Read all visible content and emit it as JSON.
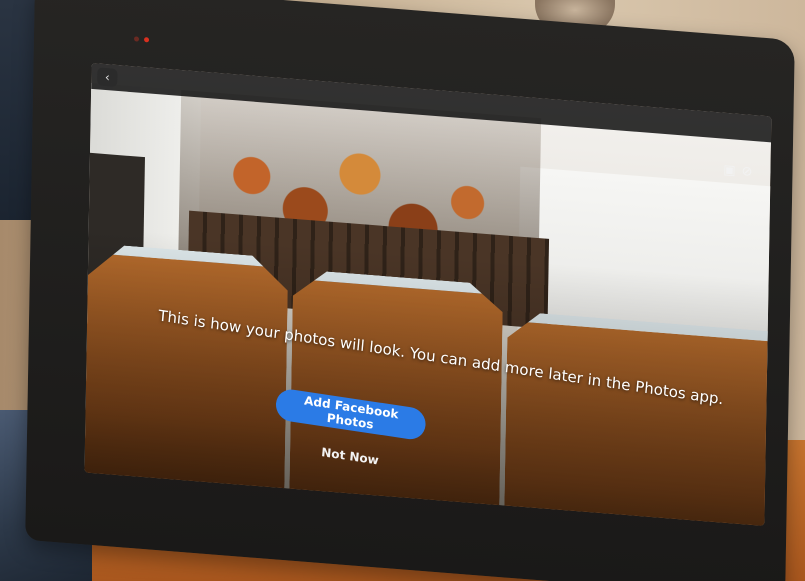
{
  "screen": {
    "back_icon": "chevron-left-icon",
    "status_icons": [
      "camera-off-icon",
      "microphone-off-icon"
    ],
    "message": "This is how your photos will look. You can add more later in the Photos app.",
    "primary_button": "Add Facebook Photos",
    "secondary_button": "Not Now"
  },
  "colors": {
    "primary_button_bg": "#2b7be6",
    "device_bezel": "#1f1e1c",
    "table": "#b8652a",
    "fence_wood": "#a85f27"
  }
}
